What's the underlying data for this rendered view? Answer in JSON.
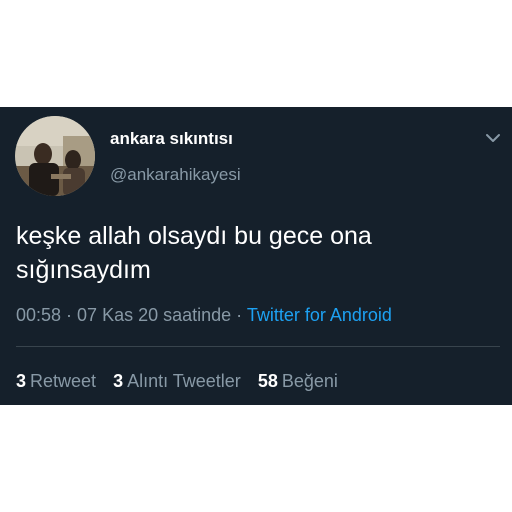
{
  "tweet": {
    "display_name": "ankara sıkıntısı",
    "handle": "@ankarahikayesi",
    "text_lines": [
      "keşke allah olsaydı bu gece ona",
      "sığınsaydım"
    ],
    "time": "00:58",
    "separator": " · ",
    "date": "07 Kas 20 saatinde",
    "source": "Twitter for Android",
    "menu_icon": "chevron-down-icon",
    "avatar_icon": "profile-photo"
  },
  "stats": [
    {
      "count": "3",
      "label": "Retweet"
    },
    {
      "count": "3",
      "label": "Alıntı Tweetler"
    },
    {
      "count": "58",
      "label": "Beğeni"
    }
  ],
  "colors": {
    "background": "#15202b",
    "text_primary": "#ffffff",
    "text_secondary": "#8899a6",
    "accent": "#1da1f2",
    "divider": "#38444d"
  }
}
